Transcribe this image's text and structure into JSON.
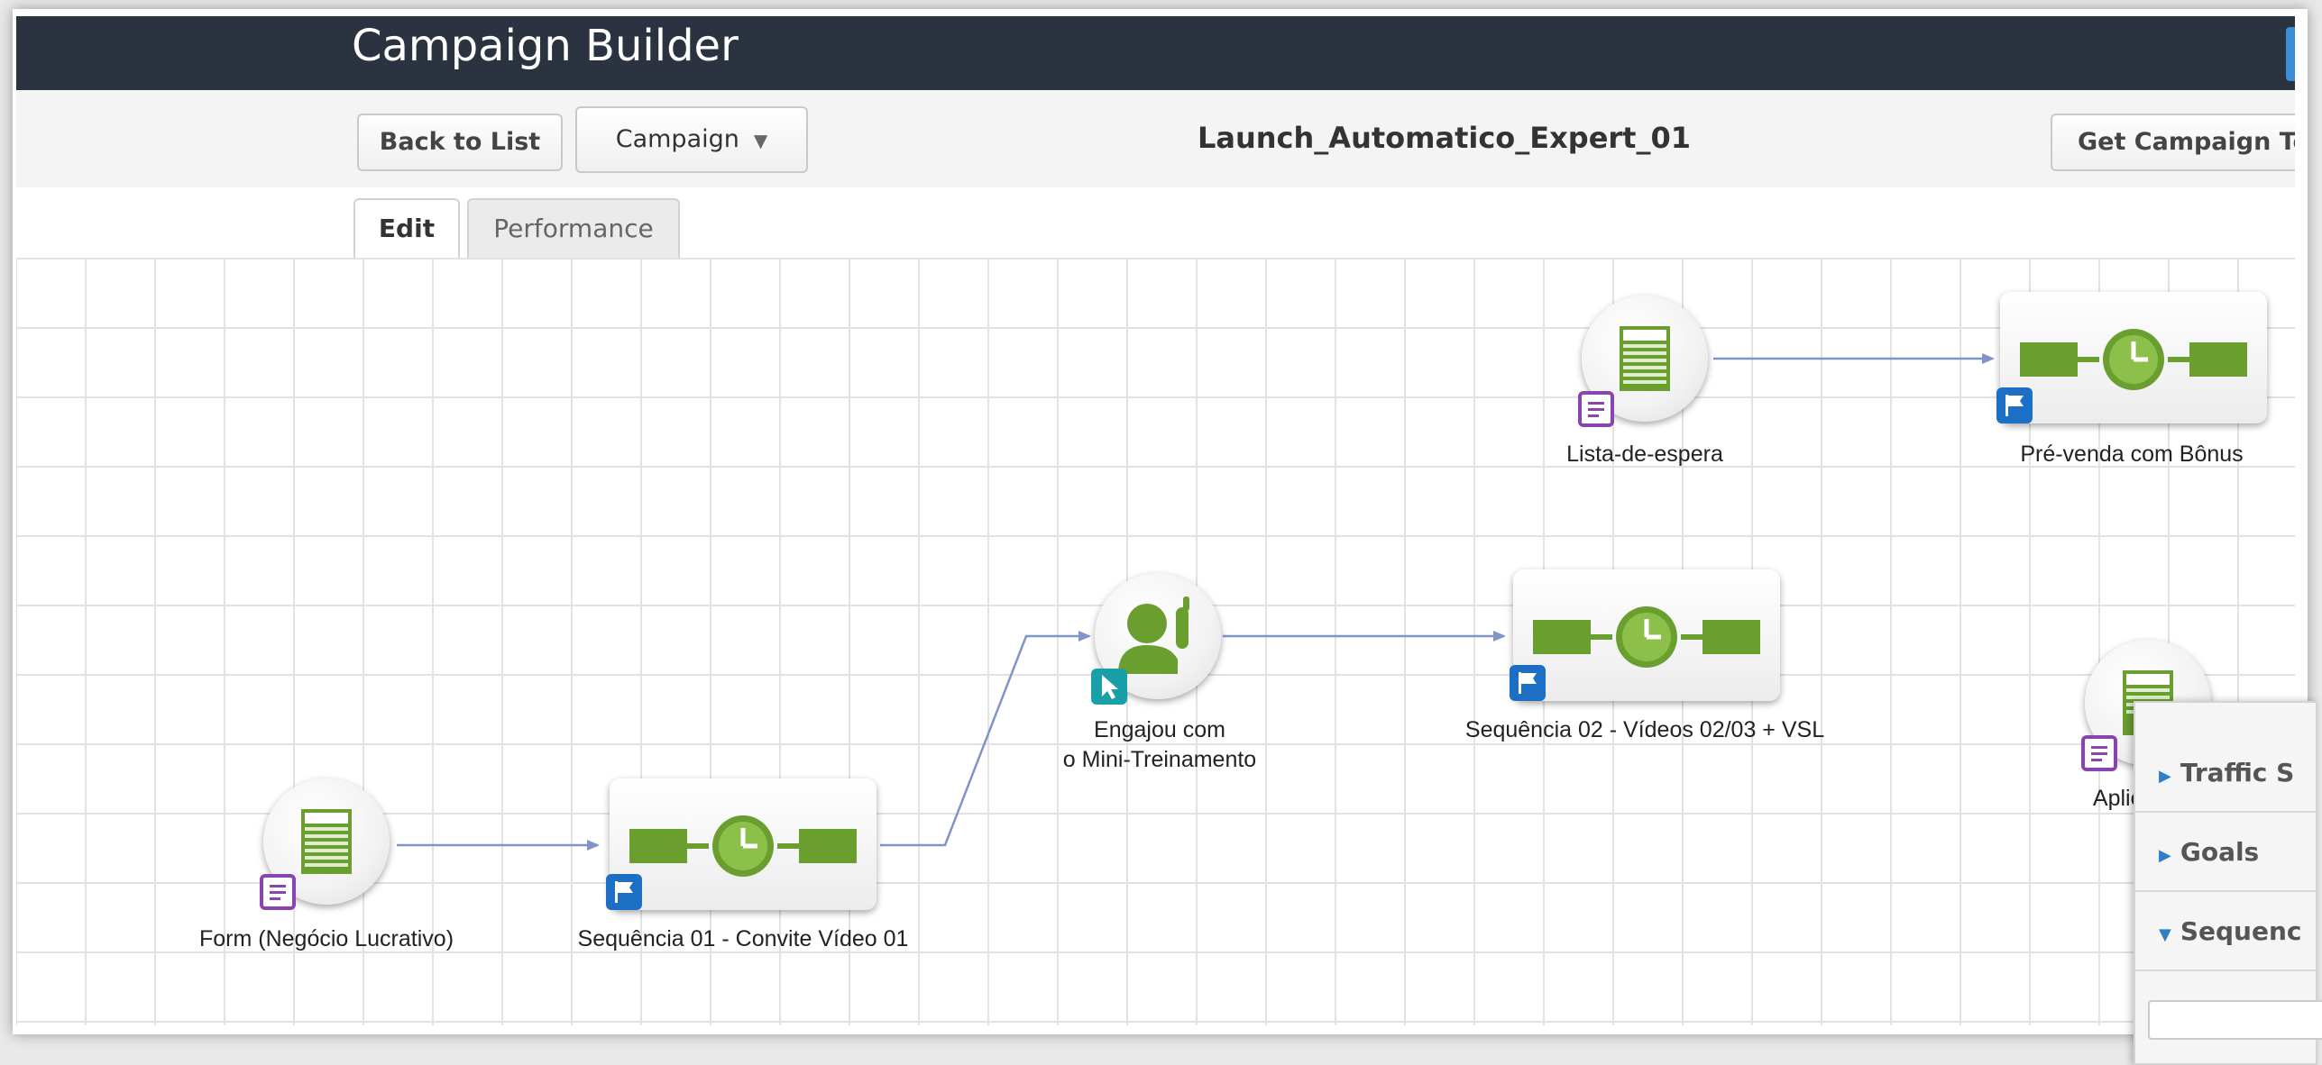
{
  "app_title": "Campaign Builder",
  "toolbar": {
    "back_label": "Back to List",
    "campaign_label": "Campaign",
    "campaign_name": "Launch_Automatico_Expert_01",
    "get_template_label": "Get Campaign Te"
  },
  "tabs": [
    {
      "label": "Edit",
      "active": true
    },
    {
      "label": "Performance",
      "active": false
    }
  ],
  "nodes": {
    "form_negocio": {
      "label": "Form (Negócio Lucrativo)",
      "type": "web-form",
      "badge": "form-badge-icon"
    },
    "sequencia_01": {
      "label": "Sequência 01 - Convite Vídeo 01",
      "type": "sequence",
      "badge": "flag-badge-icon"
    },
    "engajou": {
      "label_line1": "Engajou com",
      "label_line2": "o Mini-Treinamento",
      "type": "link-click-goal",
      "badge": "cursor-badge-icon"
    },
    "sequencia_02": {
      "label": "Sequência 02 - Vídeos 02/03 + VSL",
      "type": "sequence",
      "badge": "flag-badge-icon"
    },
    "lista_espera": {
      "label": "Lista-de-espera",
      "type": "web-form",
      "badge": "form-badge-icon"
    },
    "pre_venda": {
      "label": "Pré-venda com Bônus",
      "type": "sequence",
      "badge": "flag-badge-icon"
    },
    "aplic": {
      "label": "Aplic",
      "type": "web-form",
      "badge": "form-badge-icon"
    }
  },
  "side_panel": {
    "items": [
      {
        "label": "Traffic S",
        "expanded": false
      },
      {
        "label": "Goals",
        "expanded": false
      },
      {
        "label": "Sequenc",
        "expanded": true
      }
    ]
  },
  "colors": {
    "topbar": "#2c3340",
    "node_green": "#6a9f2f",
    "connector": "#7f95c8",
    "form_badge": "#8a44b0",
    "sequence_badge": "#1c6fc4",
    "click_badge": "#199fa8"
  }
}
